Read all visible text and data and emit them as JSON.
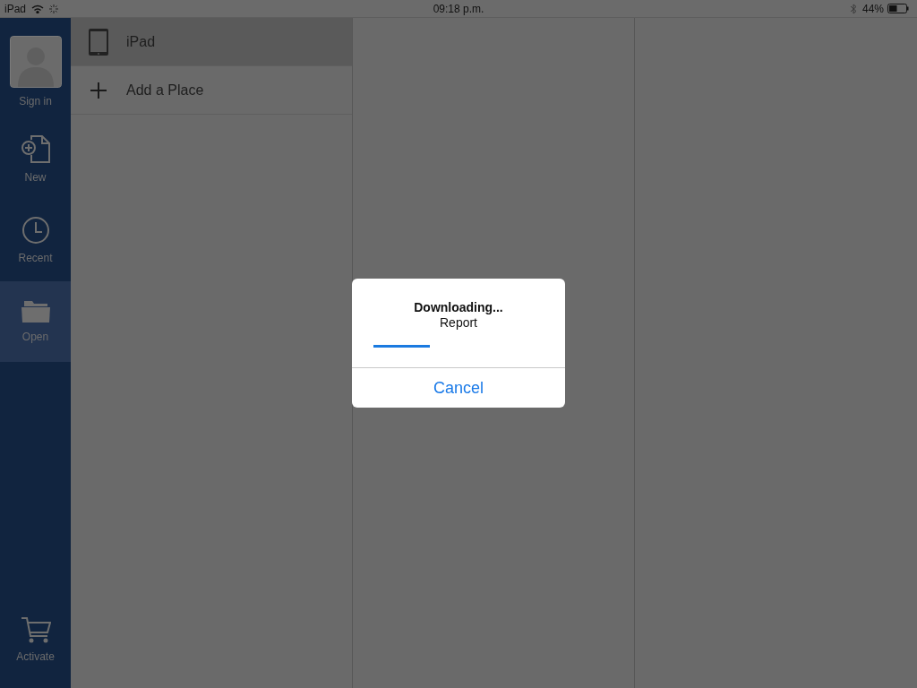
{
  "status_bar": {
    "device": "iPad",
    "time": "09:18 p.m.",
    "battery": "44%"
  },
  "sidebar": {
    "items": [
      {
        "label": "Sign in",
        "kind": "account",
        "selected": false
      },
      {
        "label": "New",
        "kind": "new",
        "selected": false
      },
      {
        "label": "Recent",
        "kind": "recent",
        "selected": false
      },
      {
        "label": "Open",
        "kind": "open",
        "selected": true
      }
    ],
    "footer": {
      "label": "Activate"
    }
  },
  "places": [
    {
      "label": "iPad",
      "kind": "device",
      "selected": true
    },
    {
      "label": "Add a Place",
      "kind": "add",
      "selected": false
    }
  ],
  "dialog": {
    "title": "Downloading...",
    "subtitle": "Report",
    "level": 0.33,
    "button": "Cancel"
  }
}
